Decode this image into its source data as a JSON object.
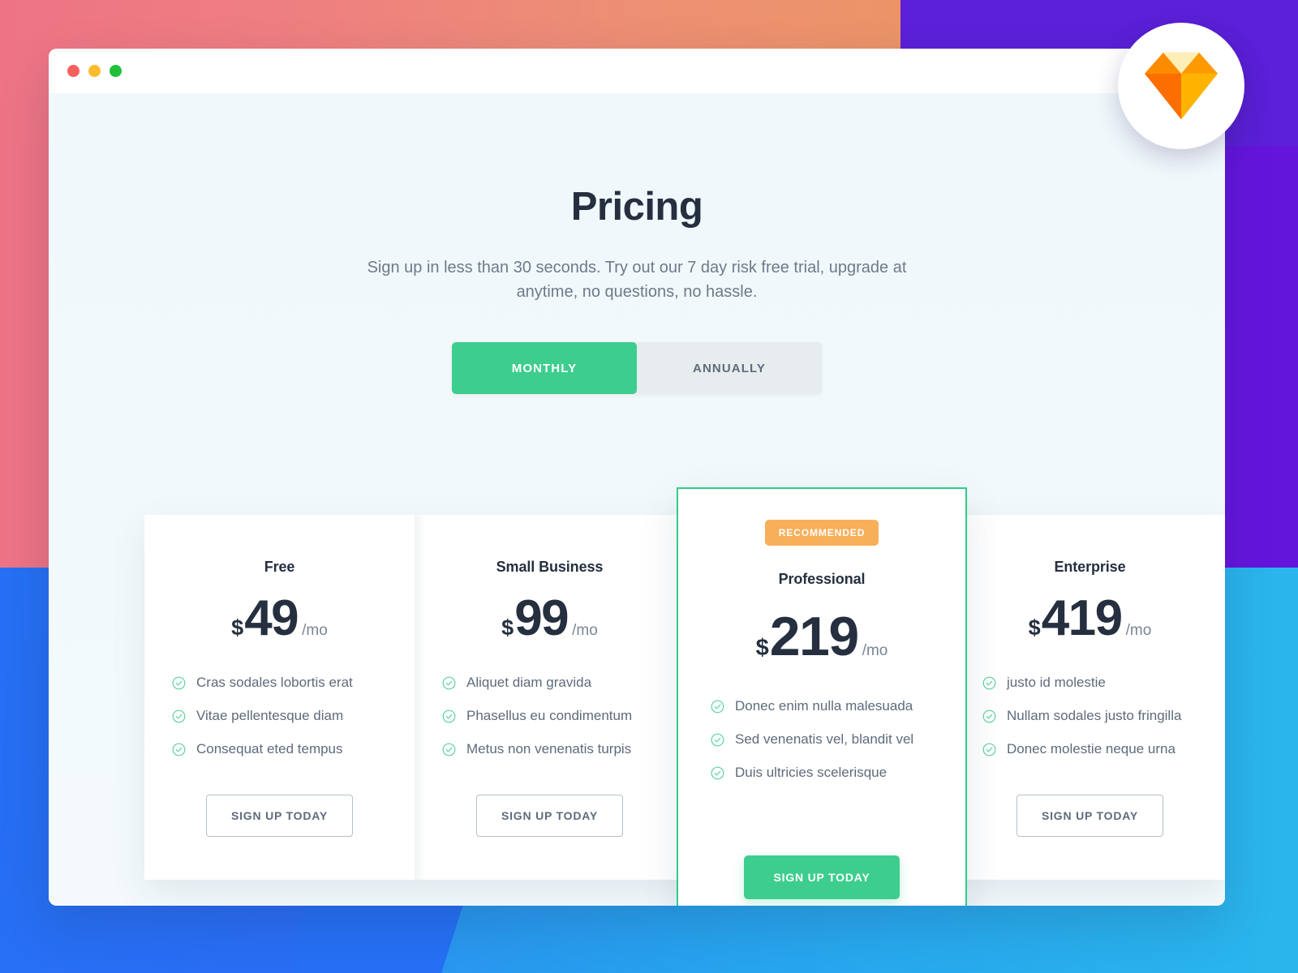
{
  "window": {
    "traffic_lights": [
      {
        "name": "close",
        "color": "#F8605B"
      },
      {
        "name": "minimize",
        "color": "#FCBC2C"
      },
      {
        "name": "maximize",
        "color": "#21C03A"
      }
    ]
  },
  "header": {
    "title": "Pricing",
    "subtitle": "Sign up in less than 30 seconds. Try out our 7 day risk free trial, upgrade at anytime, no questions, no hassle."
  },
  "billing_toggle": {
    "options": [
      {
        "label": "MONTHLY",
        "active": true
      },
      {
        "label": "ANNUALLY",
        "active": false
      }
    ],
    "active_color": "#3DCE8E",
    "track_color": "#E7ECEE"
  },
  "plans": [
    {
      "name": "Free",
      "currency": "$",
      "amount": "49",
      "period": "/mo",
      "recommended": false,
      "features": [
        "Cras sodales lobortis erat",
        "Vitae pellentesque diam",
        "Consequat eted tempus"
      ],
      "cta_label": "SIGN UP TODAY"
    },
    {
      "name": "Small Business",
      "currency": "$",
      "amount": "99",
      "period": "/mo",
      "recommended": false,
      "features": [
        "Aliquet diam gravida",
        "Phasellus eu condimentum",
        "Metus non venenatis turpis"
      ],
      "cta_label": "SIGN UP TODAY"
    },
    {
      "name": "Professional",
      "currency": "$",
      "amount": "219",
      "period": "/mo",
      "recommended": true,
      "badge_label": "RECOMMENDED",
      "features": [
        "Donec enim nulla malesuada",
        "Sed venenatis vel, blandit vel",
        "Duis ultricies scelerisque"
      ],
      "cta_label": "SIGN UP TODAY"
    },
    {
      "name": "Enterprise",
      "currency": "$",
      "amount": "419",
      "period": "/mo",
      "recommended": false,
      "features": [
        "justo id molestie",
        "Nullam sodales justo fringilla",
        "Donec molestie neque urna"
      ],
      "cta_label": "SIGN UP TODAY"
    }
  ],
  "icons": {
    "check": "check-circle-icon",
    "logo": "sketch-diamond-icon"
  },
  "colors": {
    "accent_green": "#3DCE8E",
    "check_green": "#5DD39E",
    "badge_orange": "#F8AF5A",
    "heading": "#252F3F",
    "body_text": "#6E7A8A",
    "page_bg": "#F2F9FB",
    "bg_pink": "#EE7485",
    "bg_orange": "#EC9468",
    "bg_purple": "#6415DC",
    "bg_blue": "#2570F4",
    "bg_cyan": "#2AB6ED"
  }
}
